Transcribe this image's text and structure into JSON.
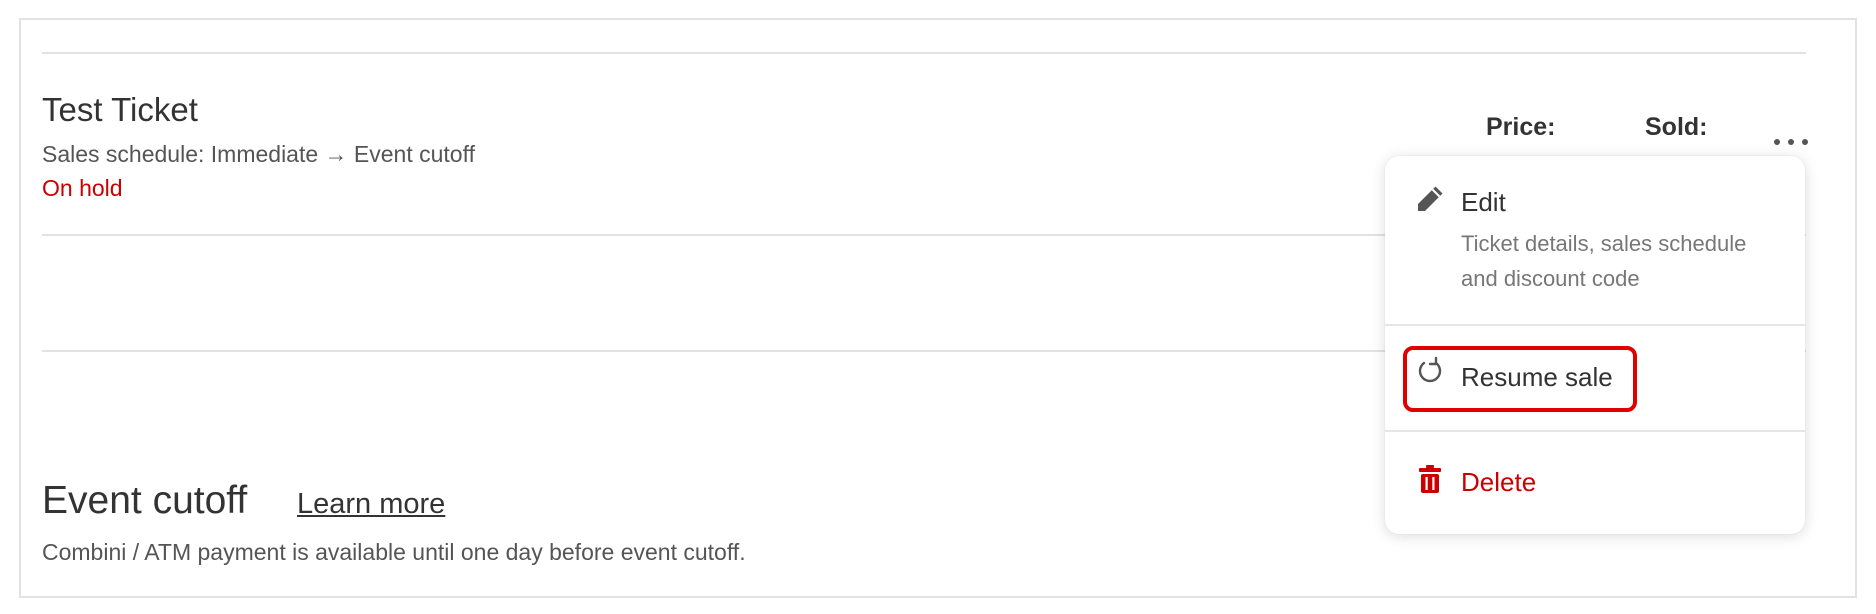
{
  "ticket": {
    "name": "Test Ticket",
    "schedule": "Sales schedule: Immediate → Event cutoff",
    "status": "On hold",
    "price_label": "Price:",
    "sold_label": "Sold:",
    "more_icon": "more-horizontal-icon"
  },
  "menu": {
    "edit": {
      "label": "Edit",
      "description": "Ticket details, sales schedule and discount code",
      "icon": "pencil-icon"
    },
    "resume": {
      "label": "Resume sale",
      "icon": "refresh-icon",
      "highlighted": true
    },
    "delete": {
      "label": "Delete",
      "icon": "trash-icon",
      "color": "#cc0000"
    }
  },
  "cutoff": {
    "title": "Event cutoff",
    "learn_more": "Learn more",
    "note": "Combini / ATM payment is available until one day before event cutoff."
  },
  "colors": {
    "danger": "#cc0000",
    "highlight": "#e00000",
    "divider": "#e2e2e2"
  }
}
